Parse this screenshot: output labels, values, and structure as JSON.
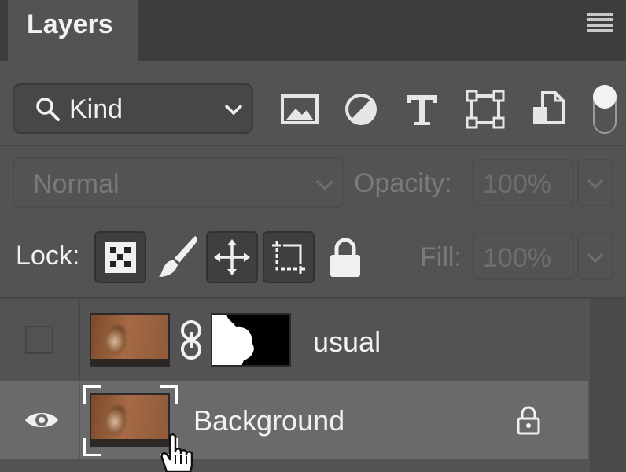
{
  "panel": {
    "tab_title": "Layers",
    "menu_icon": "hamburger-menu-icon"
  },
  "filter": {
    "kind_label": "Kind",
    "icons": [
      "image-filter-icon",
      "adjustment-filter-icon",
      "type-filter-icon",
      "shape-filter-icon",
      "smart-object-filter-icon"
    ],
    "toggle_state": "on"
  },
  "blend": {
    "mode": "Normal",
    "opacity_label": "Opacity:",
    "opacity_value": "100%"
  },
  "lock": {
    "label": "Lock:",
    "fill_label": "Fill:",
    "fill_value": "100%"
  },
  "layers": [
    {
      "name": "usual",
      "visible": false,
      "has_mask": true,
      "locked": false,
      "selected": false
    },
    {
      "name": "Background",
      "visible": true,
      "has_mask": false,
      "locked": true,
      "selected": true
    }
  ],
  "colors": {
    "panel_bg": "#535353",
    "tab_bar_bg": "#3d3d3d",
    "selected_row_bg": "#6a6a6a",
    "text": "#f2f2f2",
    "disabled_text": "#7a7a7a"
  }
}
